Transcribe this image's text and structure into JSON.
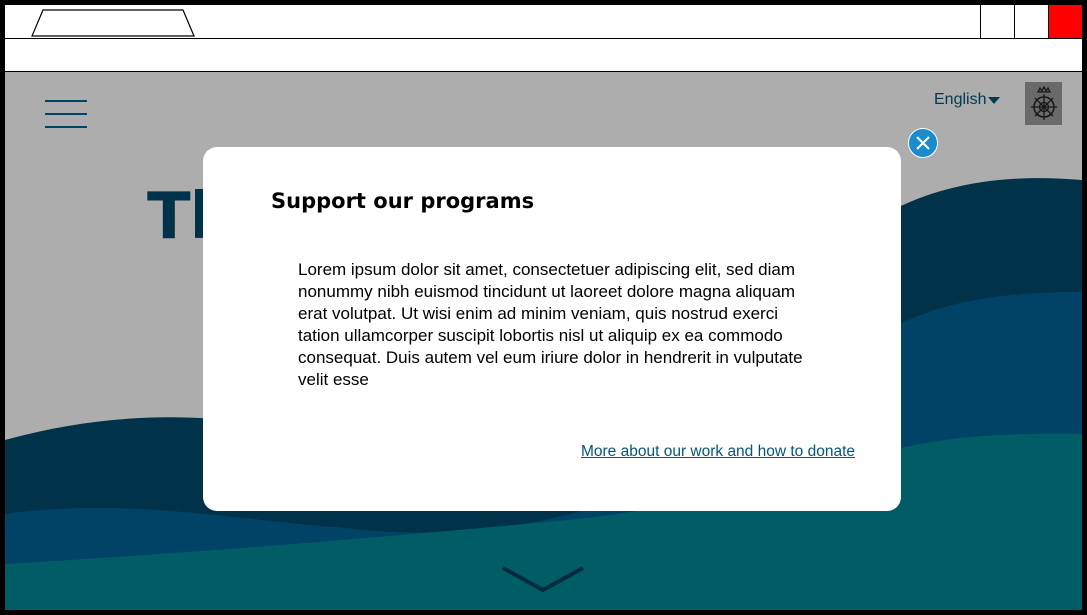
{
  "browser": {
    "tab_title": "",
    "address": ""
  },
  "header": {
    "language_label": "English"
  },
  "hero": {
    "title_visible": "Th"
  },
  "modal": {
    "title": "Support our programs",
    "body": "Lorem ipsum dolor sit amet, consectetuer adipiscing elit, sed diam nonummy nibh euismod tincidunt ut laoreet dolore magna aliquam erat volutpat. Ut wisi enim ad minim veniam, quis nostrud exerci tation ullamcorper suscipit lobortis nisl ut aliquip ex ea commodo consequat. Duis autem vel eum iriure dolor in hendrerit in vulputate velit esse",
    "link_label": "More about our work and how to donate"
  },
  "icons": {
    "menu": "hamburger-menu-icon",
    "language_caret": "caret-down-icon",
    "logo": "emblem-logo-icon",
    "modal_close": "close-icon",
    "scroll": "chevron-down-icon"
  },
  "colors": {
    "wave_dark": "#004b6e",
    "wave_mid": "#006497",
    "wave_teal": "#008a95",
    "close_button": "#1a8ccc",
    "link": "#00577e",
    "window_close": "#ff0000"
  }
}
